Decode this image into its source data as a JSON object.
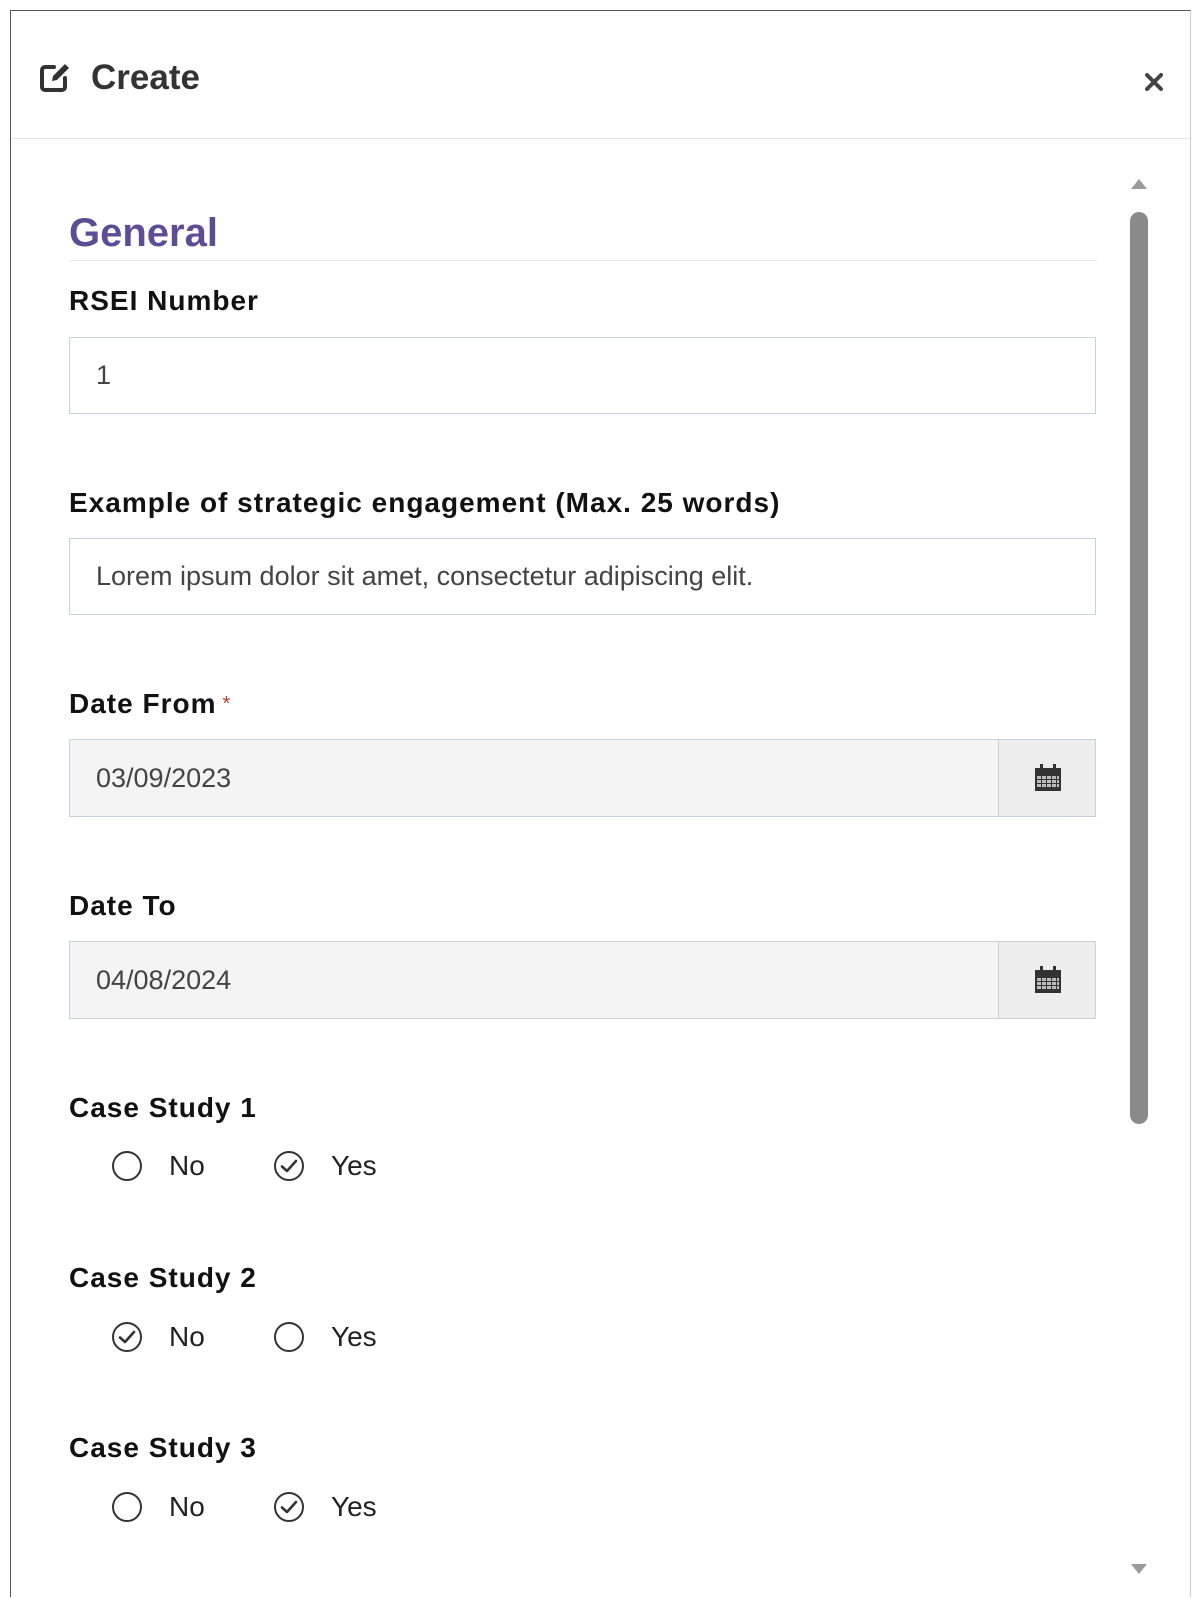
{
  "dialog": {
    "title": "Create",
    "icon": "edit-icon",
    "close_icon": "close-icon"
  },
  "section": {
    "title": "General"
  },
  "fields": {
    "rsei_number": {
      "label": "RSEI Number",
      "value": "1"
    },
    "example": {
      "label": "Example of strategic engagement (Max. 25 words)",
      "value": "Lorem ipsum dolor sit amet, consectetur adipiscing elit."
    },
    "date_from": {
      "label": "Date From",
      "required_mark": "*",
      "value": "03/09/2023",
      "icon": "calendar-icon"
    },
    "date_to": {
      "label": "Date To",
      "value": "04/08/2024",
      "icon": "calendar-icon"
    }
  },
  "case_studies": [
    {
      "label": "Case Study 1",
      "options": [
        "No",
        "Yes"
      ],
      "selected": "Yes"
    },
    {
      "label": "Case Study 2",
      "options": [
        "No",
        "Yes"
      ],
      "selected": "No"
    },
    {
      "label": "Case Study 3",
      "options": [
        "No",
        "Yes"
      ],
      "selected": "Yes"
    }
  ],
  "colors": {
    "accent": "#5c4e96",
    "required": "#c0392b",
    "border": "#c9d0e2"
  }
}
